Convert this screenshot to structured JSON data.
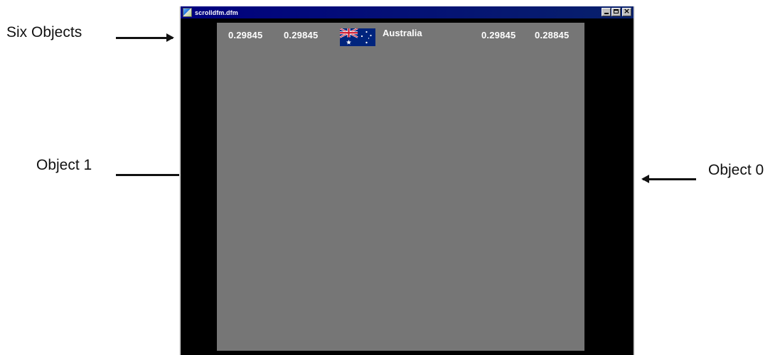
{
  "annotations": {
    "six_objects": "Six Objects",
    "object_1": "Object 1",
    "object_0": "Object 0"
  },
  "window": {
    "title": "scrolldfm.dfm",
    "buttons": [
      "minimize",
      "maximize",
      "close"
    ]
  },
  "ticker": {
    "values_left": [
      "0.29845",
      "0.29845"
    ],
    "country": "Australia",
    "flag_icon": "australia-flag-icon",
    "values_right": [
      "0.29845",
      "0.28845"
    ]
  },
  "colors": {
    "titlebar": "#000080",
    "panel": "#767676",
    "background": "#000000",
    "text": "#ffffff"
  }
}
